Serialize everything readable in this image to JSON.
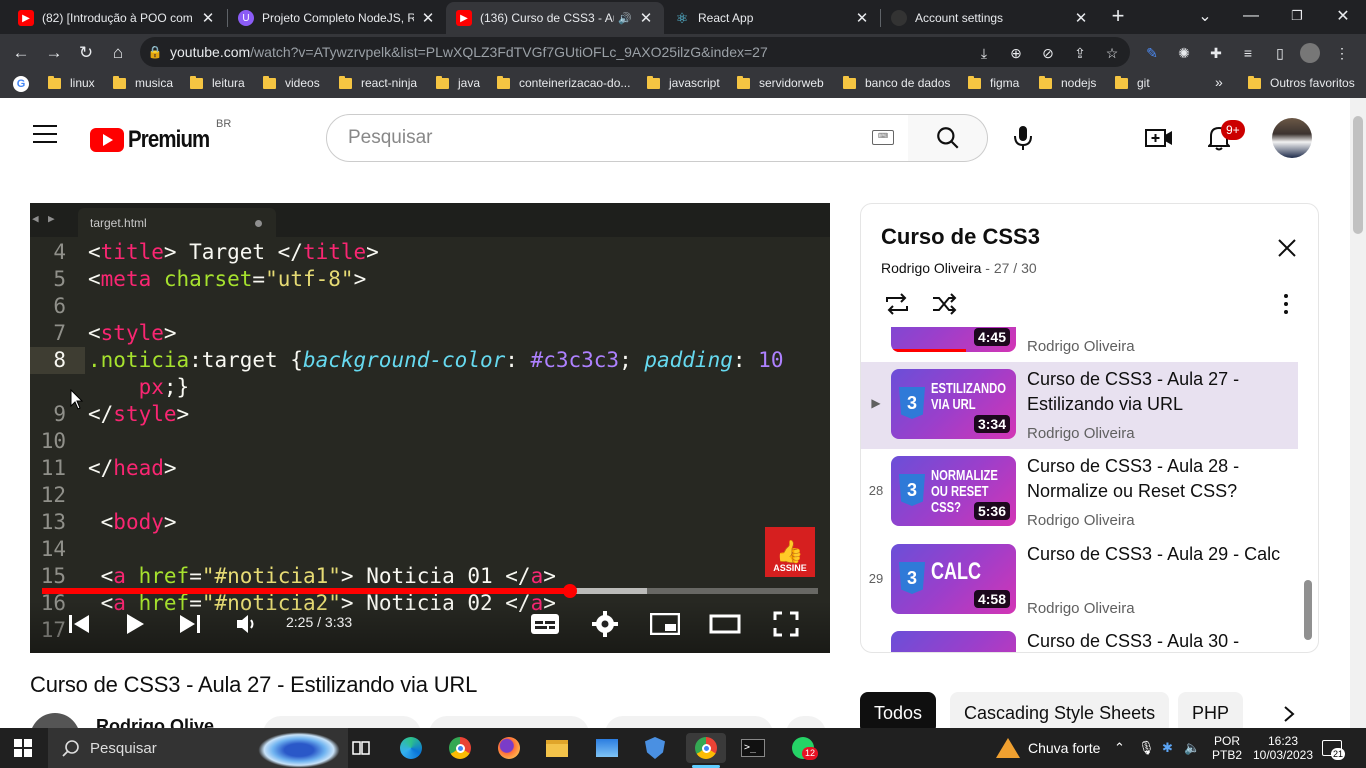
{
  "browser": {
    "tabs": [
      {
        "title": "(82) [Introdução à POO com",
        "icon": "youtube-icon"
      },
      {
        "title": "Projeto Completo NodeJS, Re",
        "icon": "udemy-icon"
      },
      {
        "title": "(136) Curso de CSS3 - Au",
        "icon": "youtube-icon"
      },
      {
        "title": "React App",
        "icon": "react-icon"
      },
      {
        "title": "Account settings",
        "icon": "github-icon"
      }
    ],
    "url_host": "youtube.com",
    "url_rest": "/watch?v=ATywzrvpelk&list=PLwXQLZ3FdTVGf7GUtiOFLc_9AXO25ilzG&index=27",
    "bookmarks": [
      "linux",
      "musica",
      "leitura",
      "videos",
      "react-ninja",
      "java",
      "conteinerizacao-do...",
      "javascript",
      "servidorweb",
      "banco de dados",
      "figma",
      "nodejs",
      "git"
    ],
    "other_bookmarks": "Outros favoritos",
    "more_bookmarks": "»"
  },
  "youtube": {
    "logo_text": "Premium",
    "region": "BR",
    "search_placeholder": "Pesquisar",
    "notifications_badge": "9+"
  },
  "video": {
    "editor_tab": "target.html",
    "code_lines": [
      {
        "n": "4"
      },
      {
        "n": "5"
      },
      {
        "n": "6"
      },
      {
        "n": "7"
      },
      {
        "n": "8"
      },
      {
        "n": ""
      },
      {
        "n": "9"
      },
      {
        "n": "10"
      },
      {
        "n": "11"
      },
      {
        "n": "12"
      },
      {
        "n": "13"
      },
      {
        "n": "14"
      },
      {
        "n": "15"
      },
      {
        "n": "16"
      },
      {
        "n": "17"
      }
    ],
    "subscribe_label": "ASSINE",
    "time_current": "2:25",
    "time_separator": " / ",
    "time_total": "3:33",
    "progress": 0.68,
    "buffered": 0.78,
    "title": "Curso de CSS3 - Aula 27 - Estilizando via URL",
    "channel_name": "Rodrigo Olive..."
  },
  "playlist": {
    "title": "Curso de CSS3",
    "owner": "Rodrigo Oliveira",
    "position": "27 / 30",
    "separator": " - ",
    "items": [
      {
        "index": "",
        "thumb_text": "",
        "duration": "4:45",
        "title": "",
        "author": "Rodrigo Oliveira"
      },
      {
        "index": "▶",
        "thumb_text": "Estilizando via URL",
        "duration": "3:34",
        "title": "Curso de CSS3 - Aula 27 - Estilizando via URL",
        "author": "Rodrigo Oliveira"
      },
      {
        "index": "28",
        "thumb_text": "Normalize ou Reset CSS?",
        "duration": "5:36",
        "title": "Curso de CSS3 - Aula 28 - Normalize ou Reset CSS?",
        "author": "Rodrigo Oliveira"
      },
      {
        "index": "29",
        "thumb_text": "Calc",
        "duration": "4:58",
        "title": "Curso de CSS3 - Aula 29 - Calc",
        "author": "Rodrigo Oliveira"
      },
      {
        "index": "",
        "thumb_text": "",
        "duration": "",
        "title": "Curso de CSS3 - Aula 30 -",
        "author": ""
      }
    ]
  },
  "chips": [
    "Todos",
    "Cascading Style Sheets",
    "PHP"
  ],
  "taskbar": {
    "search": "Pesquisar",
    "weather": "Chuva forte",
    "lang1": "POR",
    "lang2": "PTB2",
    "time": "16:23",
    "date": "10/03/2023",
    "notif_count": "21",
    "whatsapp_badge": "12"
  },
  "colors": {
    "youtube_red": "#ff0000",
    "current_item": "#e8e1f0",
    "chrome_dark": "#202124"
  }
}
